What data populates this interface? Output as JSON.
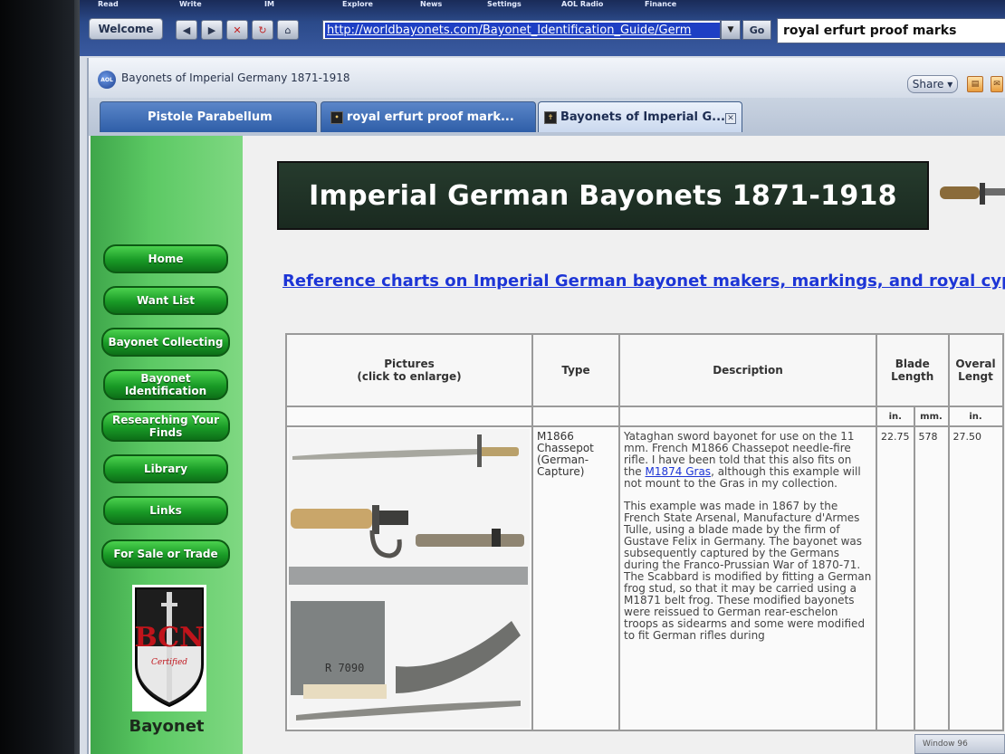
{
  "aol": {
    "menu": [
      "Read",
      "Write",
      "IM",
      "Explore",
      "News",
      "Settings",
      "AOL Radio",
      "Finance"
    ],
    "welcome_label": "Welcome",
    "address_url": "http://worldbayonets.com/Bayonet_Identification_Guide/Germ",
    "go_label": "Go",
    "search_query": "royal erfurt proof marks"
  },
  "window": {
    "title": "Bayonets of Imperial Germany 1871-1918",
    "share_label": "Share"
  },
  "tabs": [
    {
      "label": "Pistole Parabellum",
      "active": false
    },
    {
      "label": "royal erfurt proof mark...",
      "active": false
    },
    {
      "label": "Bayonets of Imperial G...",
      "active": true
    }
  ],
  "sidebar": {
    "items": [
      "Home",
      "Want List",
      "Bayonet Collecting",
      "Bayonet Identification",
      "Researching Your Finds",
      "Library",
      "Links",
      "For Sale or Trade"
    ],
    "badge_text": "BCN",
    "badge_sub": "Certified",
    "footer_text": "Bayonet"
  },
  "page": {
    "banner_title": "Imperial German Bayonets 1871-1918",
    "reference_link": "Reference charts on Imperial German bayonet makers, markings, and royal cypher"
  },
  "table": {
    "headers": {
      "pictures": "Pictures\n(click to enlarge)",
      "type": "Type",
      "description": "Description",
      "blade_length": "Blade Length",
      "overall_length": "Overal Lengt"
    },
    "units": [
      "in.",
      "mm.",
      "in."
    ],
    "row": {
      "type": "M1866 Chassepot (German-Capture)",
      "description_p1_before": "Yataghan sword bayonet for use on the 11 mm. French M1866 Chassepot needle-fire rifle. I have been told that this also fits on the ",
      "description_link": "M1874 Gras",
      "description_p1_after": ", although this example will not mount to the Gras in my collection.",
      "description_p2": "This example was made in 1867 by the French State Arsenal, Manufacture d'Armes Tulle, using a blade made by the firm of Gustave Felix in Germany. The bayonet was subsequently captured by the Germans during the Franco-Prussian War of 1870-71. The Scabbard is modified by fitting a German frog stud, so that it may be carried using a M1871 belt frog. These modified bayonets were reissued to German rear-eschelon troops as sidearms and some were modified to fit German rifles during",
      "blade_in": "22.75",
      "blade_mm": "578",
      "overall_in": "27.50",
      "stamp_text": "R 7090"
    }
  },
  "status_text": "Window 96",
  "colors": {
    "sidebar_green": "#5cc964",
    "button_green": "#199a26",
    "banner_bg": "#1f3326",
    "link_blue": "#1d35d6",
    "tab_blue": "#2e5ea8"
  }
}
